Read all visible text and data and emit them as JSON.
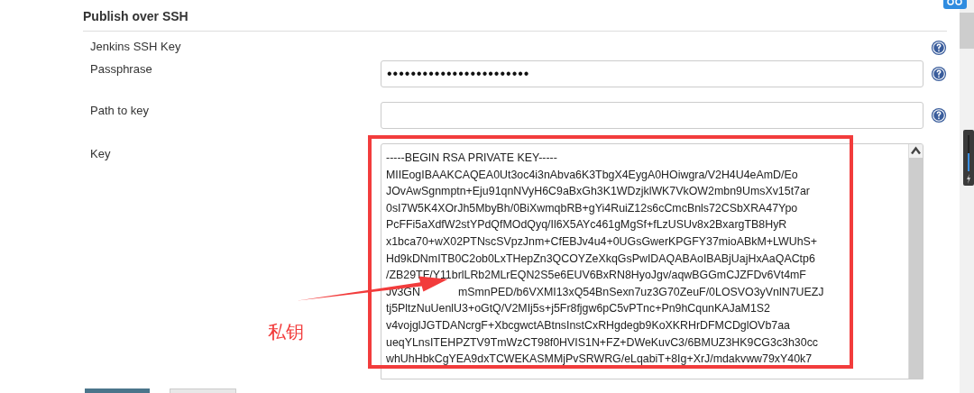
{
  "section": {
    "title": "Publish over SSH"
  },
  "fields": [
    {
      "kind": "label",
      "label": "Jenkins SSH Key",
      "help": true
    },
    {
      "kind": "input",
      "label": "Passphrase",
      "value": "••••••••••••••••••••••••",
      "help": true
    },
    {
      "kind": "input",
      "label": "Path to key",
      "help": true
    },
    {
      "kind": "textarea",
      "label": "Key",
      "help": false
    }
  ],
  "key_lines": [
    [
      "-----BEGIN RSA PRIVATE KEY-----"
    ],
    [
      "MIIEogIBAAKCAQEA0Ut3oc4i3nAbva6K3TbgX4EygA0HOiwgra/V2H4U4eAmD/Eo"
    ],
    [
      "JOvAwSgnmptn+Eju91qnNVyH6C9aBxGh3K1WDzjklWK7VkOW2mbn9UmsXv15t7ar"
    ],
    [
      "0sI7W5K4XOrJh5MbyBh/0BiXwmqbRB+gYi4RuiZ12s6cCmcBnls72CSbXRA47Ypo"
    ],
    [
      "PcFFi5aXdfW2stYPdQfMOdQyq/Il6X5AYc461gMgSf+fLzUSUv8x2BxargTB8HyR"
    ],
    [
      "x1bca70+wX02PTNscSVpzJnm+CfEBJv4u4+0UGsGwerKPGFY37mioABkM+LWUhS+"
    ],
    [
      "Hd9kDNmITB0C2ob0LxTHepZn3QCOYZeXkqGsPwIDAQABAoIBABjUajHxAaQACtp6"
    ],
    [
      "/ZB29TF/Y11brlLRb2MLrEQN2S5e6EUV6BxRN8HyoJgv/aqwBGGmCJZFDv6Vt4mF"
    ],
    [
      "Jv3GN",
      "mSmnPED/b6VXMI13xQ54BnSexn7uz3G70ZeuF/0LOSVO3yVnlN7UEZJ"
    ],
    [
      "tj5PltzNuUenlU3+oGtQ/V2MIj5s+j5Fr8fjgw6pC5vPTnc+Pn9hCqunKAJaM1S2"
    ],
    [
      "v4vojglJGTDANcrgF+XbcgwctABtnsInstCxRHgdegb9KoXKRHrDFMCDglOVb7aa"
    ],
    [
      "ueqYLnsITEHPZTV9TmWzCT98f0HVIS1N+FZ+DWeKuvC3/6BMUZ3HK9CG3c3h30cc"
    ],
    [
      "whUhHbkCgYEA9dxTCWEKASMMjPvSRWRG/eLqabiT+8Ig+XrJ/mdakvww79xY40k7"
    ]
  ],
  "annotation": {
    "text": "私钥",
    "color": "#f23c3c"
  },
  "buttons": [
    {
      "kind": "primary"
    },
    {
      "kind": "secondary"
    }
  ]
}
